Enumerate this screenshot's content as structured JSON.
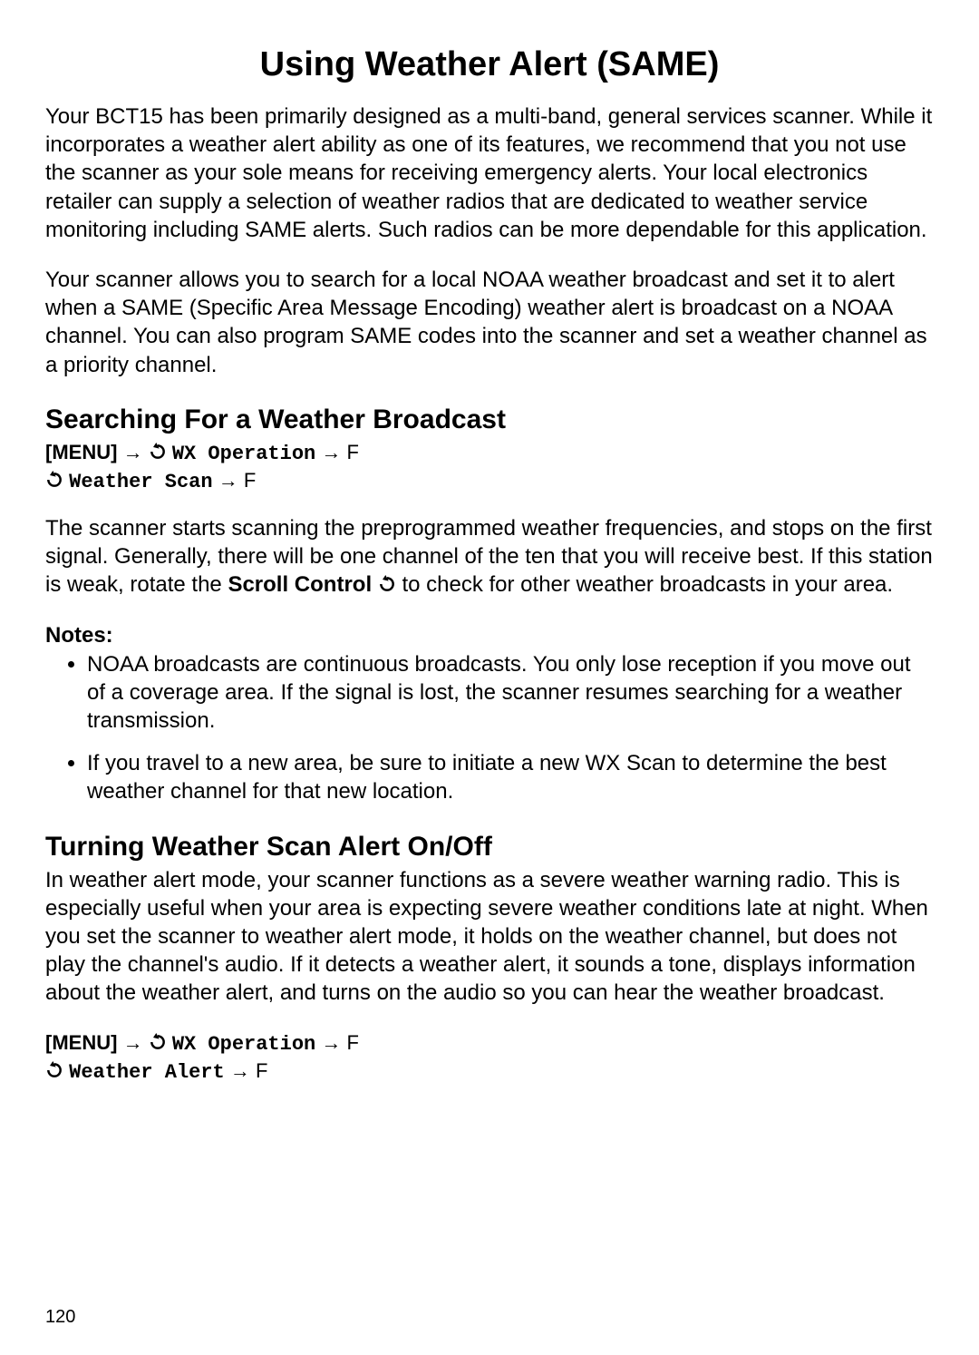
{
  "title": "Using Weather Alert (SAME)",
  "intro1": "Your BCT15 has been primarily designed as a multi-band, general services scanner. While it incorporates a weather alert ability as one of its features, we recommend that you not use the scanner as your sole means for receiving emergency alerts. Your local electronics retailer can supply a selection of weather radios that are dedicated to weather service monitoring including SAME alerts. Such radios can be more dependable for this application.",
  "intro2": "Your scanner allows you to search for a local NOAA weather broadcast and set it to alert when a SAME (Specific Area Message Encoding) weather alert is broadcast on a NOAA channel. You can also program SAME codes into the scanner and set a weather channel as a priority channel.",
  "section1": {
    "heading": "Searching For a Weather Broadcast",
    "path": {
      "menu": "[MENU]",
      "step1": "WX Operation",
      "step2": "Weather Scan",
      "fkey": "F"
    },
    "para_pre": "The scanner starts scanning the preprogrammed weather frequencies, and stops on the first signal. Generally, there will be one channel of the ten that you will receive best. If this station is weak, rotate the ",
    "para_strong": "Scroll Control",
    "para_post": " to check for other weather broadcasts in your area.",
    "notes_label": "Notes:",
    "notes": [
      "NOAA broadcasts are continuous broadcasts. You only lose reception if you move out of a coverage area. If the signal is lost, the scanner resumes searching for a weather transmission.",
      "If you travel to a new area, be sure to initiate a new WX Scan to determine the best weather channel for that new location."
    ]
  },
  "section2": {
    "heading": "Turning Weather Scan Alert On/Off",
    "para": "In weather alert mode, your scanner functions as a severe weather warning radio. This is especially useful when your area is expecting severe weather conditions late at night. When you set the scanner to weather alert mode, it holds on the weather channel, but does not play the channel's audio. If it detects a weather alert, it sounds a tone, displays information about the weather alert, and turns on the audio so you can hear the weather broadcast.",
    "path": {
      "menu": "[MENU]",
      "step1": "WX Operation",
      "step2": "Weather Alert",
      "fkey": "F"
    }
  },
  "page_number": "120"
}
